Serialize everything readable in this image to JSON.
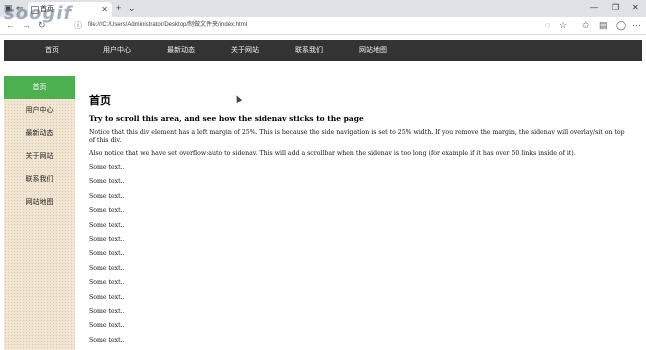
{
  "browser": {
    "tab_title": "首页",
    "tab_close": "✕",
    "new_tab": "+",
    "tab_menu": "⌄",
    "url": "file:///C:/Users/Administrator/Desktop/制做文件夹/index.html",
    "watermark": "soogif"
  },
  "topnav": {
    "items": [
      "首页",
      "用户中心",
      "最新动态",
      "关于网站",
      "联系我们",
      "网站地图"
    ]
  },
  "sidenav": {
    "items": [
      "首页",
      "用户中心",
      "最新动态",
      "关于网站",
      "联系我们",
      "网站地图"
    ],
    "active_index": 0
  },
  "content": {
    "title": "首页",
    "subtitle": "Try to scroll this area, and see how the sidenav sticks to the page",
    "para1": "Notice that this div element has a left margin of 25%. This is because the side navigation is set to 25% width. If you remove the margin, the sidenav will overlay/sit on top of this div.",
    "para2": "Also notice that we have set overflow:auto to sidenav. This will add a scrollbar when the sidenav is too long (for example if it has over 50 links inside of it).",
    "some_text": [
      "Some text..",
      "Some text..",
      "Some text..",
      "Some text..",
      "Some text..",
      "Some text..",
      "Some text..",
      "Some text..",
      "Some text..",
      "Some text..",
      "Some text..",
      "Some text..",
      "Some text.."
    ]
  },
  "colors": {
    "topnav_bg": "#333333",
    "active_bg": "#4caf50",
    "sidenav_bg": "#f1e6d4"
  }
}
